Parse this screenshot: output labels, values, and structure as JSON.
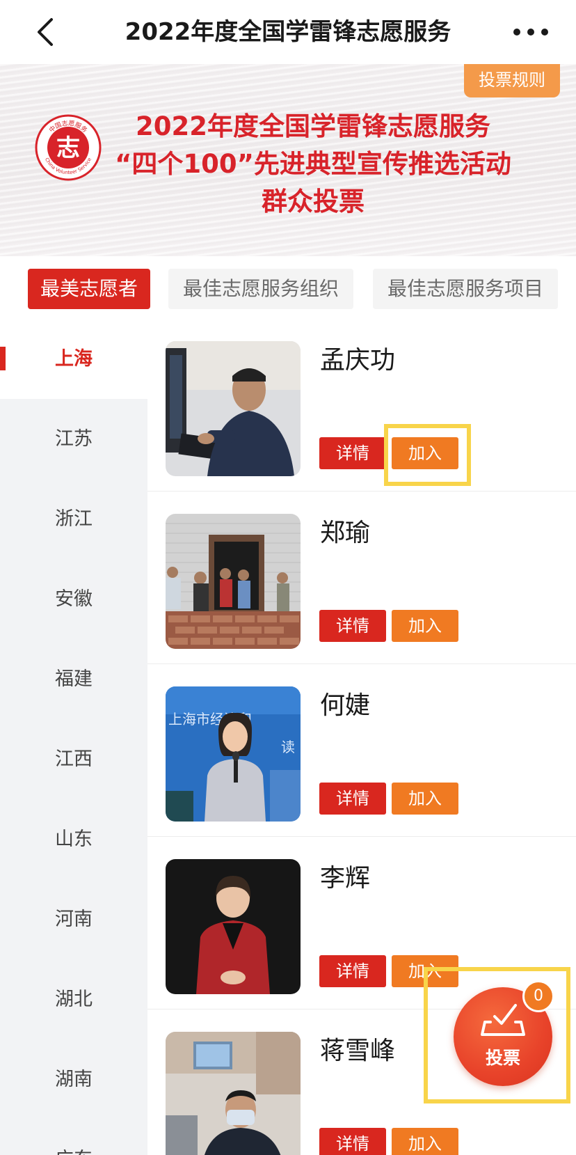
{
  "navbar": {
    "title": "2022年度全国学雷锋志愿服务",
    "back_icon": "chevron-left-icon",
    "more_icon": "more-dots-icon"
  },
  "banner": {
    "rules_button": "投票规则",
    "line1": "2022年度全国学雷锋志愿服务",
    "line2": "“四个100”先进典型宣传推选活动",
    "line3": "群众投票",
    "logo": {
      "top_text": "中国志愿服务",
      "center_char": "志",
      "bottom_text": "China Volunteer Service"
    },
    "accent_color": "#d8232a"
  },
  "categories": [
    {
      "label": "最美志愿者",
      "active": true
    },
    {
      "label": "最佳志愿服务组织",
      "active": false
    },
    {
      "label": "最佳志愿服务项目",
      "active": false
    }
  ],
  "provinces": [
    {
      "label": "上海",
      "active": true
    },
    {
      "label": "江苏",
      "active": false
    },
    {
      "label": "浙江",
      "active": false
    },
    {
      "label": "安徽",
      "active": false
    },
    {
      "label": "福建",
      "active": false
    },
    {
      "label": "江西",
      "active": false
    },
    {
      "label": "山东",
      "active": false
    },
    {
      "label": "河南",
      "active": false
    },
    {
      "label": "湖北",
      "active": false
    },
    {
      "label": "湖南",
      "active": false
    },
    {
      "label": "广东",
      "active": false
    }
  ],
  "volunteers": [
    {
      "name": "孟庆功",
      "detail_label": "详情",
      "join_label": "加入"
    },
    {
      "name": "郑瑜",
      "detail_label": "详情",
      "join_label": "加入"
    },
    {
      "name": "何婕",
      "detail_label": "详情",
      "join_label": "加入"
    },
    {
      "name": "李辉",
      "detail_label": "详情",
      "join_label": "加入"
    },
    {
      "name": "蒋雪峰",
      "detail_label": "详情",
      "join_label": "加入"
    }
  ],
  "photo3_text": {
    "line1": "上海市经济和",
    "line2": "读"
  },
  "vote_fab": {
    "label": "投票",
    "count": "0",
    "icon": "ballot-box-icon"
  },
  "colors": {
    "primary_red": "#d9271f",
    "join_orange": "#f07a22",
    "highlight_yellow": "#f8d44a"
  }
}
